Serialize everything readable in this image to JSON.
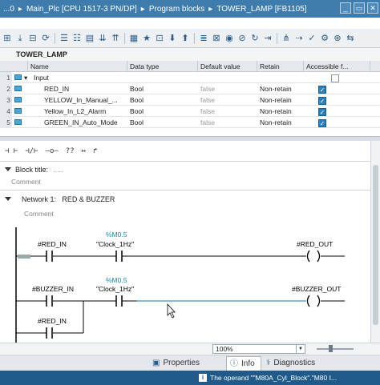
{
  "breadcrumb": [
    "...0",
    "Main_Plc [CPU 1517-3 PN/DP]",
    "Program blocks",
    "TOWER_LAMP [FB1105]"
  ],
  "window_buttons": [
    "_",
    "▭",
    "✕"
  ],
  "interface_title": "TOWER_LAMP",
  "grid": {
    "headers": [
      "Name",
      "Data type",
      "Default value",
      "Retain",
      "Accessible f..."
    ],
    "section_row": {
      "num": "1",
      "name": "Input"
    },
    "rows": [
      {
        "num": "2",
        "name": "RED_IN",
        "type": "Bool",
        "default": "false",
        "retain": "Non-retain",
        "accessible": true
      },
      {
        "num": "3",
        "name": "YELLOW_In_Manual_...",
        "type": "Bool",
        "default": "false",
        "retain": "Non-retain",
        "accessible": true
      },
      {
        "num": "4",
        "name": "Yellow_In_L2_Alarm",
        "type": "Bool",
        "default": "false",
        "retain": "Non-retain",
        "accessible": true
      },
      {
        "num": "5",
        "name": "GREEN_IN_Auto_Mode",
        "type": "Bool",
        "default": "false",
        "retain": "Non-retain",
        "accessible": true
      }
    ]
  },
  "ladder_tools": [
    "⊣ ⊢",
    "⊣/⊢",
    "–o–",
    "??",
    "↦",
    "↱"
  ],
  "block_title": {
    "label": "Block title:",
    "value": "....."
  },
  "block_comment": "Comment",
  "network": {
    "label": "Network 1:",
    "title": "RED & BUZZER",
    "comment": "Comment"
  },
  "rungs": {
    "r1_contact1": "#RED_IN",
    "r1_contact2_addr": "%M0.5",
    "r1_contact2_name": "\"Clock_1Hz\"",
    "r1_coil": "#RED_OUT",
    "r2_contact1": "#BUZZER_IN",
    "r2_contact2_addr": "%M0.5",
    "r2_contact2_name": "\"Clock_1Hz\"",
    "r2_coil": "#BUZZER_OUT",
    "r2_branch": "#RED_IN"
  },
  "zoom": "100%",
  "tabs": [
    {
      "label": "Properties",
      "icon": "properties-icon"
    },
    {
      "label": "Info",
      "icon": "info-icon",
      "active": true
    },
    {
      "label": "Diagnostics",
      "icon": "diagnostics-icon"
    }
  ],
  "status": {
    "text": "The operand \"\"M80A_Cyl_Block\".\"M80 I..."
  },
  "colors": {
    "titlebar": "#3f7cae",
    "statusbar": "#1f5a8a",
    "accent_address": "#1e8aa8"
  }
}
